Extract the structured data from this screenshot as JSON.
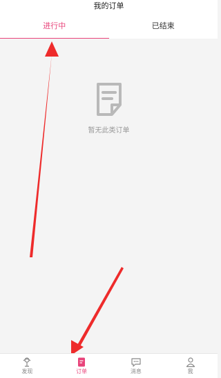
{
  "header": {
    "title": "我的订单"
  },
  "tabs": [
    {
      "label": "进行中",
      "active": true
    },
    {
      "label": "已结束",
      "active": false
    }
  ],
  "empty": {
    "message": "暂无此类订单"
  },
  "tabbar": {
    "items": [
      {
        "label": "发现",
        "icon": "discover-icon",
        "active": false
      },
      {
        "label": "订单",
        "icon": "order-icon",
        "active": true
      },
      {
        "label": "消息",
        "icon": "message-icon",
        "active": false
      },
      {
        "label": "我",
        "icon": "profile-icon",
        "active": false
      }
    ]
  },
  "colors": {
    "accent": "#e8437a",
    "arrow": "#ee2b2b",
    "background": "#f4f4f4"
  }
}
